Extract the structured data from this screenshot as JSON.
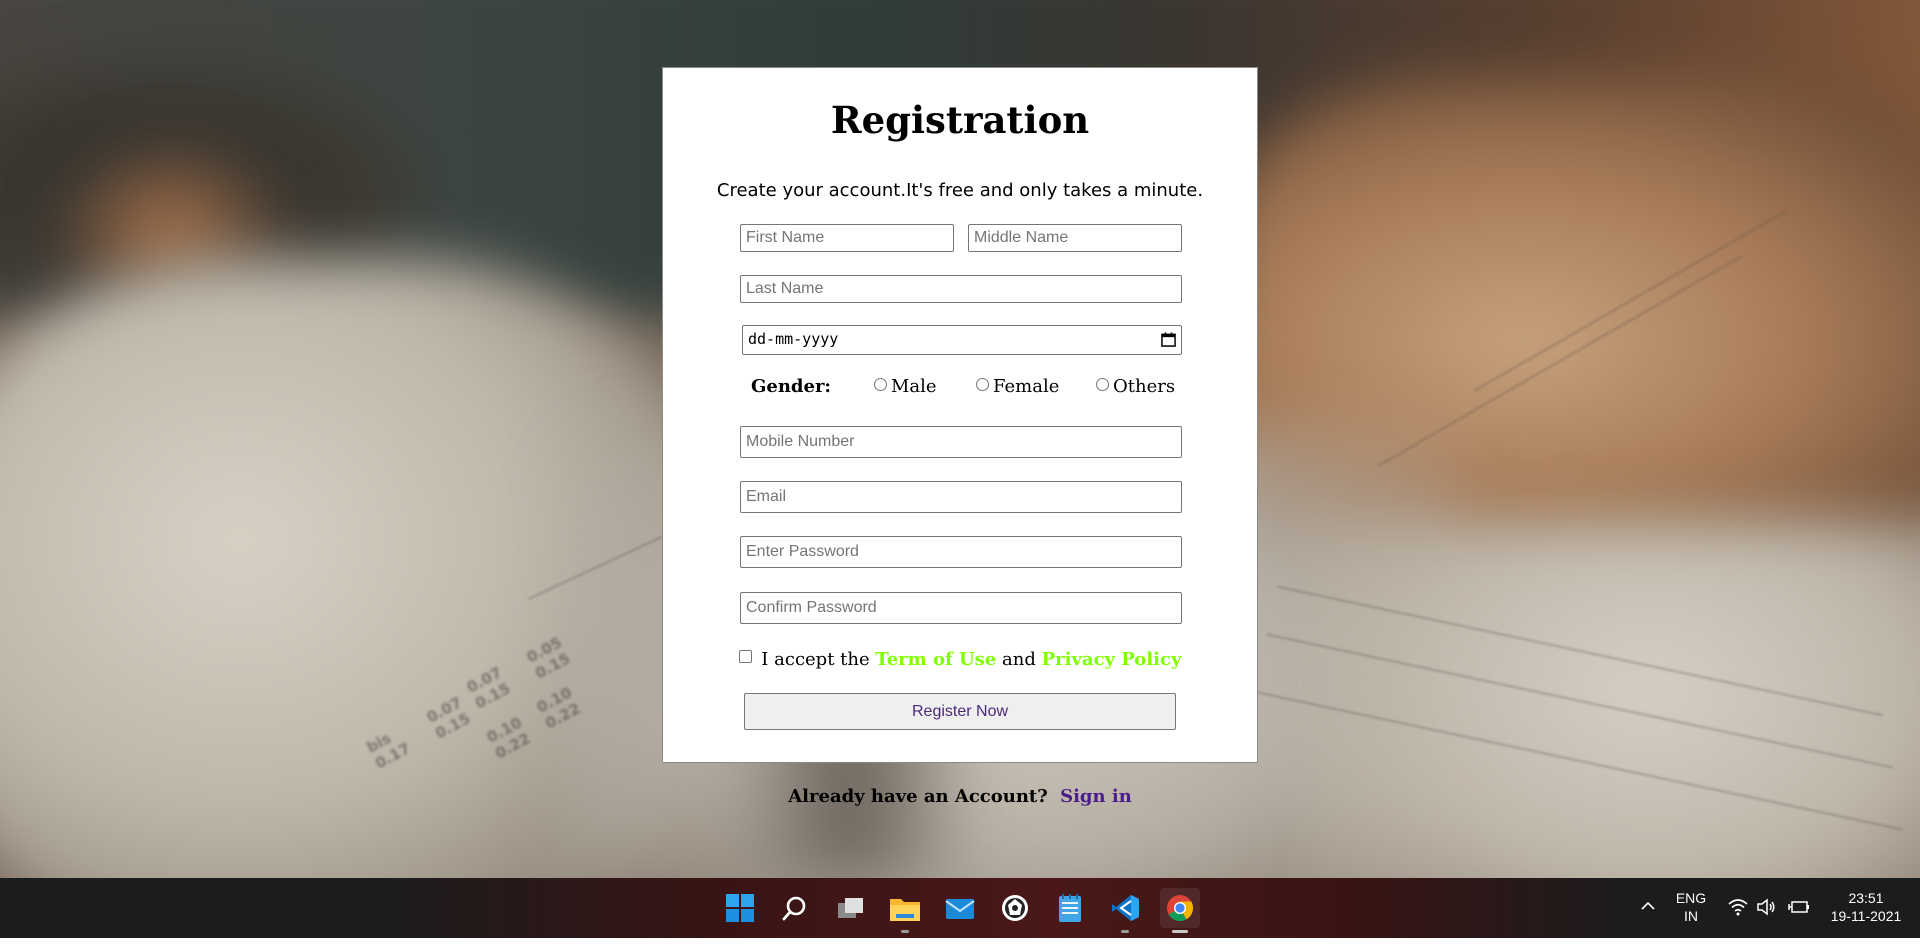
{
  "form": {
    "title": "Registration",
    "subtitle": "Create your account.It's free and only takes a minute.",
    "first_name_placeholder": "First Name",
    "middle_name_placeholder": "Middle Name",
    "last_name_placeholder": "Last Name",
    "date_placeholder": "dd-mm-yyyy",
    "gender_label": "Gender:",
    "gender_options": [
      "Male",
      "Female",
      "Others"
    ],
    "mobile_placeholder": "Mobile Number",
    "email_placeholder": "Email",
    "password_placeholder": "Enter Password",
    "confirm_placeholder": "Confirm Password",
    "accept_prefix": "I accept the",
    "terms_link": "Term of Use",
    "accept_and": "and",
    "privacy_link": "Privacy Policy",
    "register_button": "Register Now",
    "link_color": "#7fff00"
  },
  "signin": {
    "prompt": "Already have an Account?",
    "link": "Sign in"
  },
  "taskbar": {
    "apps": [
      "windows-start",
      "search",
      "task-view",
      "file-explorer",
      "mail",
      "app",
      "notepad",
      "vs-code",
      "chrome"
    ],
    "language_line1": "ENG",
    "language_line2": "IN",
    "time": "23:51",
    "date": "19-11-2021"
  }
}
